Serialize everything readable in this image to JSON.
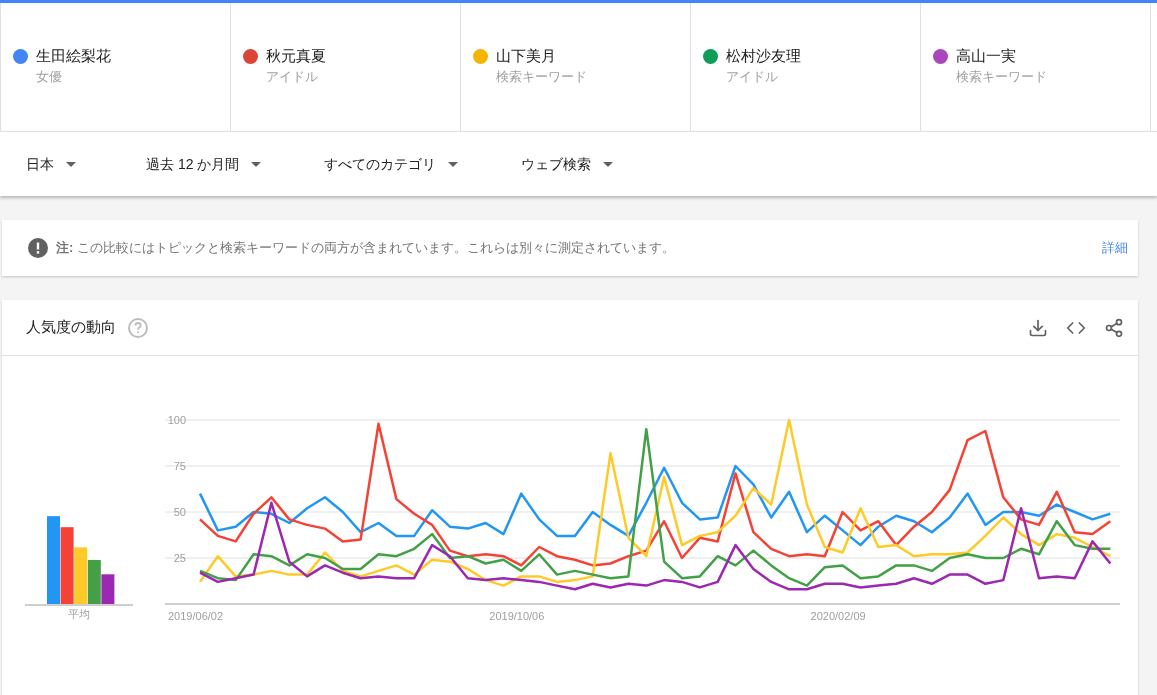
{
  "terms": [
    {
      "name": "生田絵梨花",
      "type": "女優",
      "color": "#4285f4"
    },
    {
      "name": "秋元真夏",
      "type": "アイドル",
      "color": "#db4437"
    },
    {
      "name": "山下美月",
      "type": "検索キーワード",
      "color": "#f4b400"
    },
    {
      "name": "松村沙友理",
      "type": "アイドル",
      "color": "#0f9d58"
    },
    {
      "name": "高山一実",
      "type": "検索キーワード",
      "color": "#ab47bc"
    }
  ],
  "filters": [
    {
      "label": "日本"
    },
    {
      "label": "過去 12 か月間"
    },
    {
      "label": "すべてのカテゴリ"
    },
    {
      "label": "ウェブ検索"
    }
  ],
  "note": {
    "text": "**注:** この比較にはトピックと検索キーワードの両方が含まれています。これらは別々に測定されています。",
    "link": "詳細"
  },
  "trend_card": {
    "title": "人気度の動向",
    "average_label": "平均",
    "date_labels": [
      "2019/06/02",
      "2019/10/06",
      "2020/02/09"
    ],
    "chart_data": {
      "type": "line",
      "grid": true,
      "ylim": [
        0,
        100
      ],
      "yticks": [
        25,
        50,
        75,
        100
      ],
      "series": [
        {
          "color": "#2196f3",
          "values": [
            60,
            40,
            42,
            50,
            49,
            44,
            52,
            58,
            50,
            39,
            44,
            37,
            37,
            51,
            42,
            41,
            44,
            38,
            60,
            46,
            37,
            37,
            50,
            43,
            37,
            55,
            74,
            55,
            46,
            47,
            75,
            65,
            47,
            61,
            39,
            48,
            40,
            32,
            42,
            48,
            45,
            39,
            47,
            60,
            43,
            50,
            50,
            48,
            54,
            50,
            46,
            49
          ]
        },
        {
          "color": "#f44336",
          "values": [
            46,
            37,
            34,
            49,
            58,
            46,
            43,
            41,
            34,
            35,
            98,
            57,
            49,
            43,
            29,
            26,
            27,
            26,
            21,
            31,
            26,
            24,
            21,
            22,
            26,
            29,
            45,
            25,
            36,
            34,
            71,
            39,
            30,
            26,
            27,
            26,
            50,
            40,
            45,
            32,
            42,
            50,
            62,
            89,
            94,
            58,
            46,
            43,
            61,
            39,
            38,
            45
          ]
        },
        {
          "color": "#ffca28",
          "values": [
            12,
            26,
            15,
            16,
            18,
            16,
            16,
            28,
            18,
            15,
            18,
            21,
            16,
            24,
            23,
            19,
            13,
            10,
            15,
            15,
            12,
            13,
            15,
            82,
            36,
            26,
            69,
            32,
            37,
            39,
            48,
            63,
            54,
            100,
            54,
            31,
            28,
            52,
            31,
            32,
            26,
            27,
            27,
            28,
            37,
            47,
            38,
            32,
            38,
            36,
            31,
            26
          ]
        },
        {
          "color": "#43a047",
          "values": [
            18,
            14,
            13,
            27,
            26,
            21,
            27,
            25,
            19,
            19,
            27,
            26,
            30,
            38,
            25,
            26,
            22,
            24,
            18,
            27,
            16,
            18,
            16,
            14,
            15,
            95,
            23,
            14,
            15,
            26,
            21,
            29,
            21,
            14,
            10,
            20,
            21,
            14,
            15,
            21,
            21,
            18,
            25,
            27,
            25,
            25,
            30,
            27,
            45,
            32,
            30,
            30
          ]
        },
        {
          "color": "#9c27b0",
          "values": [
            17,
            12,
            14,
            16,
            55,
            23,
            15,
            21,
            17,
            14,
            15,
            14,
            14,
            32,
            26,
            14,
            13,
            14,
            13,
            12,
            10,
            8,
            11,
            9,
            11,
            10,
            13,
            12,
            9,
            12,
            32,
            19,
            12,
            8,
            8,
            11,
            11,
            9,
            10,
            11,
            14,
            11,
            16,
            16,
            11,
            13,
            52,
            14,
            15,
            14,
            34,
            22
          ]
        }
      ]
    }
  }
}
